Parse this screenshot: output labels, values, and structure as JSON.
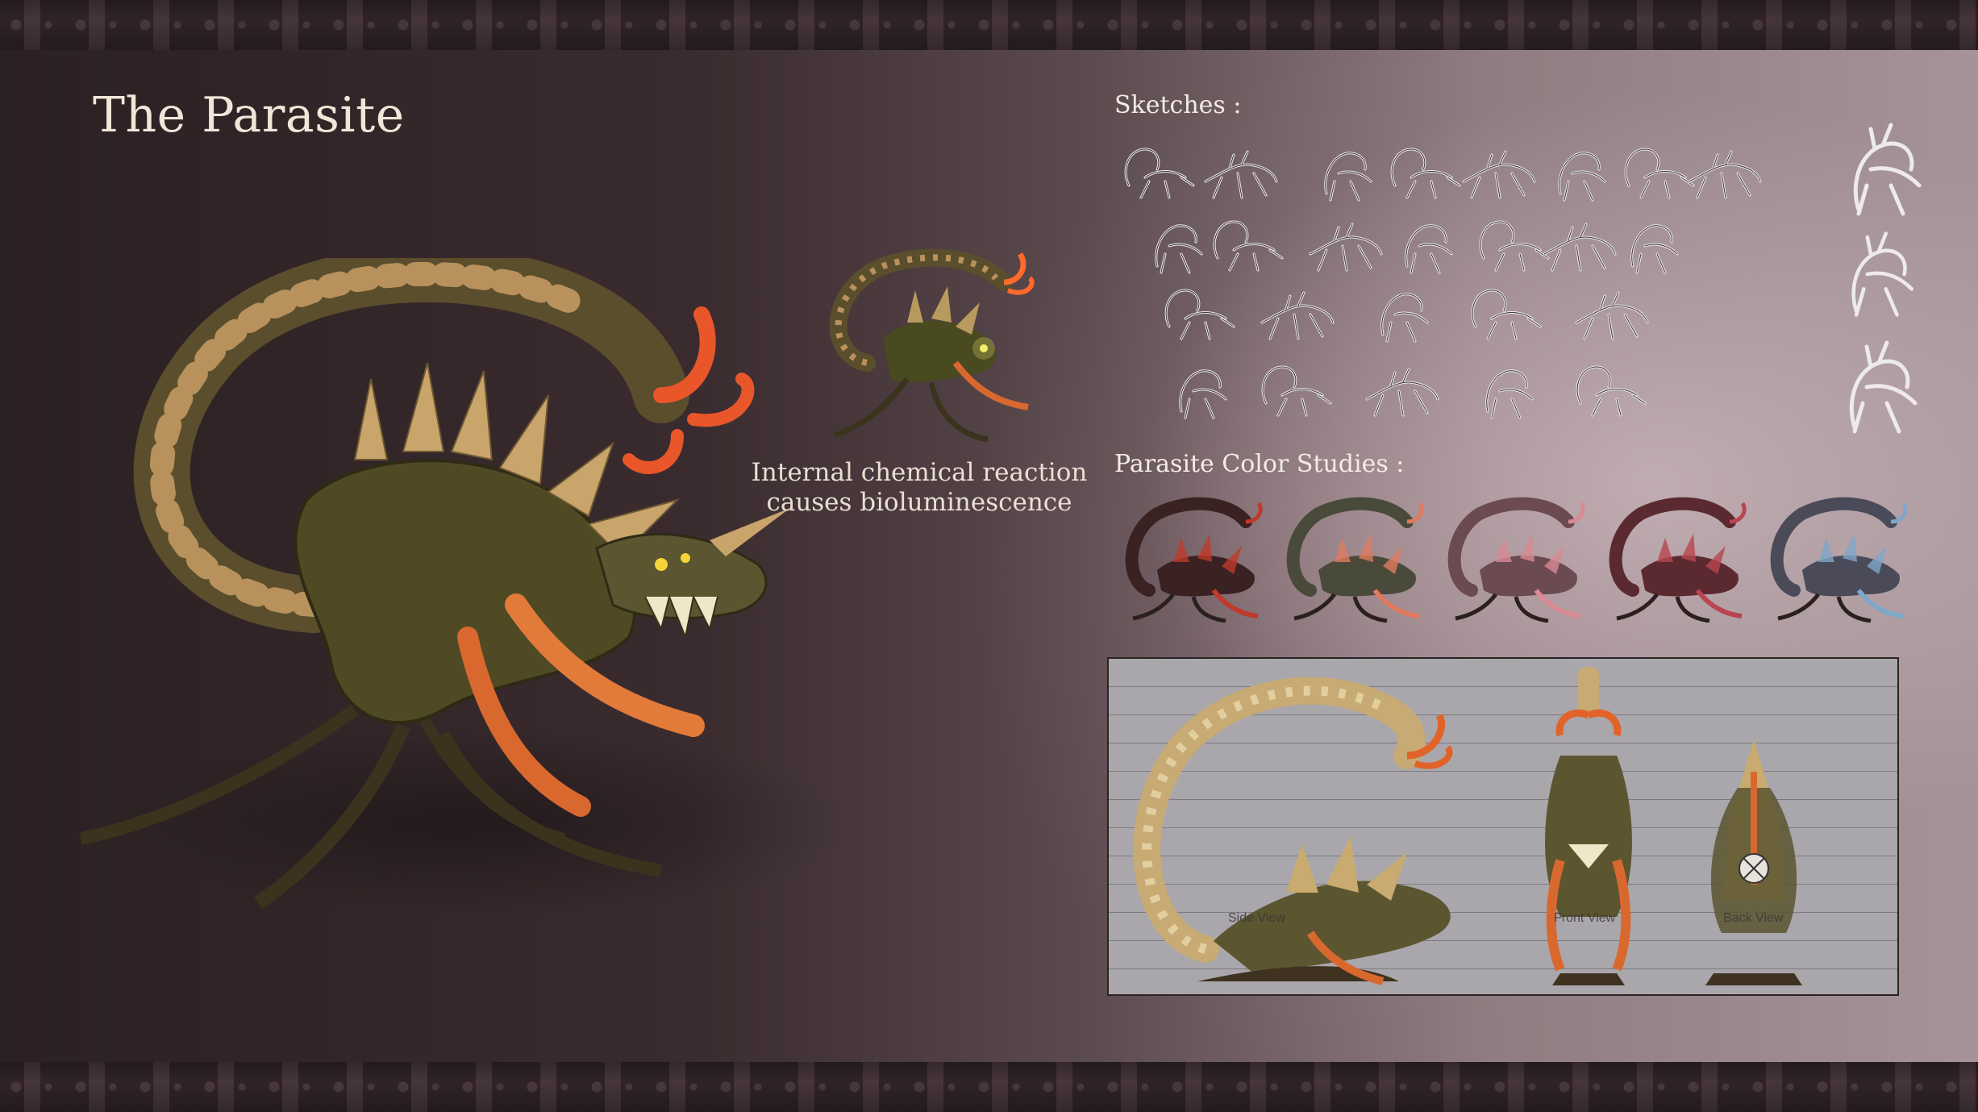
{
  "title": "The Parasite",
  "caption": {
    "line1": "Internal chemical reaction",
    "line2": "causes bioluminescence"
  },
  "sections": {
    "sketches_label": "Sketches :",
    "color_studies_label": "Parasite Color Studies :"
  },
  "turnaround": {
    "views": [
      "Side View",
      "Front View",
      "Back View"
    ]
  },
  "color_studies": [
    {
      "body": "#3a2222",
      "accent": "#c0392b"
    },
    {
      "body": "#4a4a3a",
      "accent": "#e07a5f"
    },
    {
      "body": "#6b4a52",
      "accent": "#d98a94"
    },
    {
      "body": "#5a2a30",
      "accent": "#b8454f"
    },
    {
      "body": "#4a4a58",
      "accent": "#7fa7c9"
    }
  ],
  "colors": {
    "creature_body": "#4f4a24",
    "creature_spines": "#c9a46b",
    "creature_glow": "#e8562a",
    "eye": "#f5d33a"
  }
}
